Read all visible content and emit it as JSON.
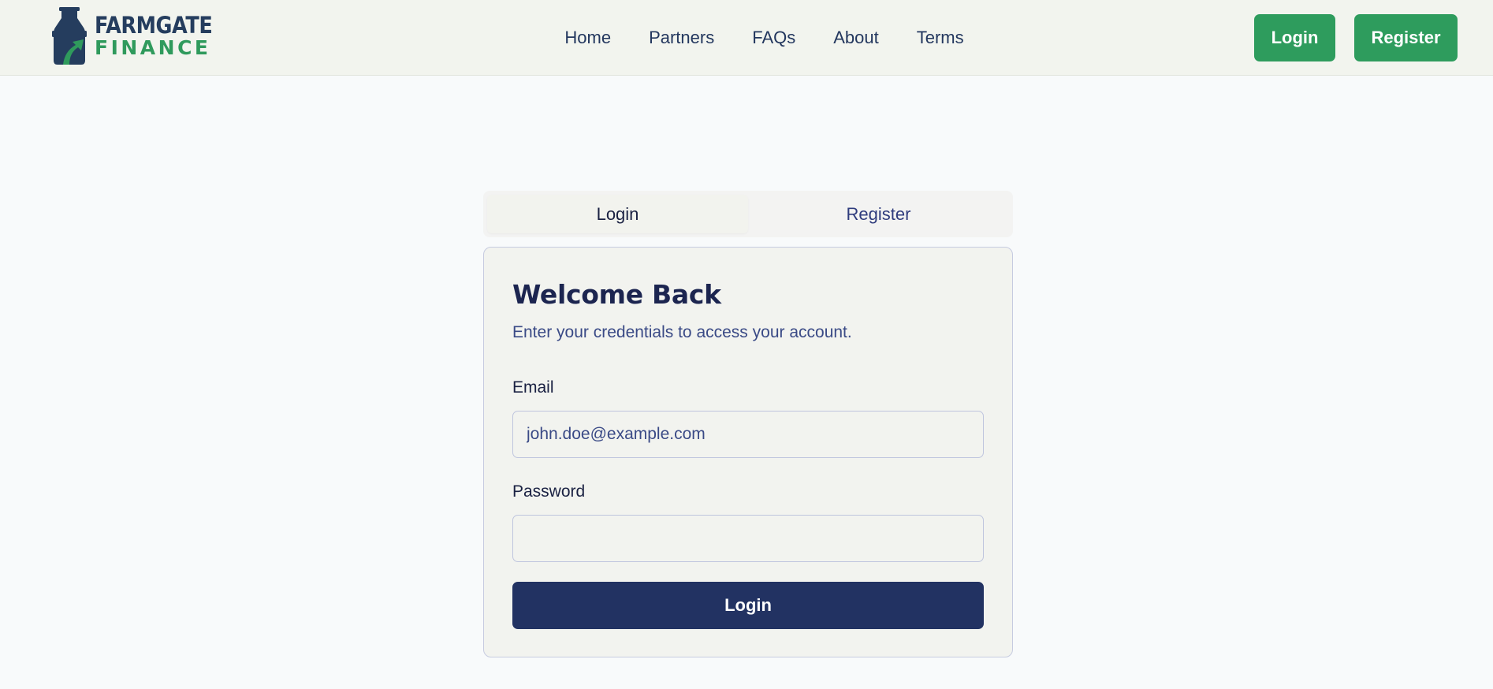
{
  "brand": {
    "line1": "FARMGATE",
    "line2": "FINANCE",
    "icon": "milk-can-logo-icon",
    "colors": {
      "navy": "#253d5e",
      "green": "#2f9a5c"
    }
  },
  "nav": {
    "items": [
      "Home",
      "Partners",
      "FAQs",
      "About",
      "Terms"
    ]
  },
  "header_actions": {
    "login_label": "Login",
    "register_label": "Register",
    "color": "#2e9c5d"
  },
  "auth_tabs": {
    "items": [
      {
        "label": "Login",
        "active": true
      },
      {
        "label": "Register",
        "active": false
      }
    ]
  },
  "login_form": {
    "title": "Welcome Back",
    "subtitle": "Enter your credentials to access your account.",
    "email": {
      "label": "Email",
      "value": "",
      "placeholder": "john.doe@example.com"
    },
    "password": {
      "label": "Password",
      "value": "",
      "placeholder": ""
    },
    "submit_label": "Login",
    "submit_color": "#223262"
  }
}
